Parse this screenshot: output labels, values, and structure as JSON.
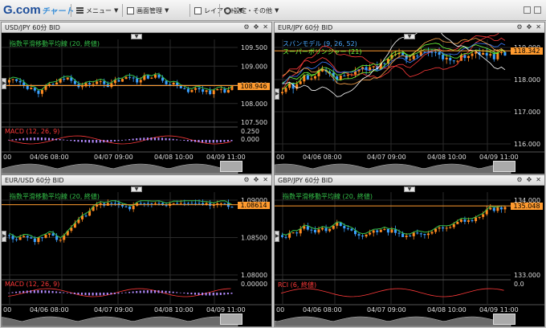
{
  "app": {
    "logo_main": "G.com",
    "logo_sub": "チャート"
  },
  "toolbar": {
    "menu_label": "メニュー",
    "screen_label": "画面管理",
    "layout_label": "レイアウト",
    "settings_label": "設定・その他"
  },
  "panels": [
    {
      "title": "USD/JPY 60分 BID",
      "indicator": "指数平滑移動平均線 (20, 終値)",
      "sub_indicator": "MACD (12, 26, 9)",
      "price": "108.946",
      "yticks": [
        "109.500",
        "109.000",
        "108.500",
        "108.000",
        "107.500"
      ],
      "sub_yticks": [
        "0.250",
        "0.000"
      ],
      "xticks": [
        "00",
        "04/06 08:00",
        "04/07 09:00",
        "04/08 10:00",
        "04/09 11:00"
      ],
      "colors": {
        "up": "#ff8a1f",
        "down": "#3aa0ff",
        "ma": "#35c04a",
        "macd": "#ff3a3a"
      }
    },
    {
      "title": "EUR/JPY 60分 BID",
      "indicator": "スパンモデル (9, 26, 52)",
      "indicator2": "スーパーボリンジャー (21)",
      "price": "118.342",
      "yticks": [
        "119.000",
        "118.000",
        "117.000",
        "116.000"
      ],
      "xticks": [
        "00",
        "04/06 08:00",
        "04/07 09:00",
        "04/08 10:00",
        "04/09 11:00"
      ],
      "colors": {
        "span": "#4aa8ff",
        "boll": "#6cff3a"
      }
    },
    {
      "title": "EUR/USD 60分 BID",
      "indicator": "指数平滑移動平均線 (20, 終値)",
      "sub_indicator": "MACD (12, 26, 9)",
      "price": "1.08614",
      "yticks": [
        "1.09000",
        "1.08500",
        "1.08000"
      ],
      "sub_yticks": [
        "0.00000"
      ],
      "xticks": [
        "00",
        "04/06 08:00",
        "04/07 09:00",
        "04/08 10:00",
        "04/09 11:00"
      ]
    },
    {
      "title": "GBP/JPY 60分 BID",
      "indicator": "指数平滑移動平均線 (20, 終値)",
      "sub_indicator": "RCI (6, 終値)",
      "price": "135.048",
      "yticks": [
        "134.000",
        "133.000"
      ],
      "sub_yticks": [
        "0.0"
      ],
      "xticks": [
        "00",
        "04/06 08:00",
        "04/07 09:00",
        "04/08 10:00",
        "04/09 11:00"
      ]
    }
  ]
}
